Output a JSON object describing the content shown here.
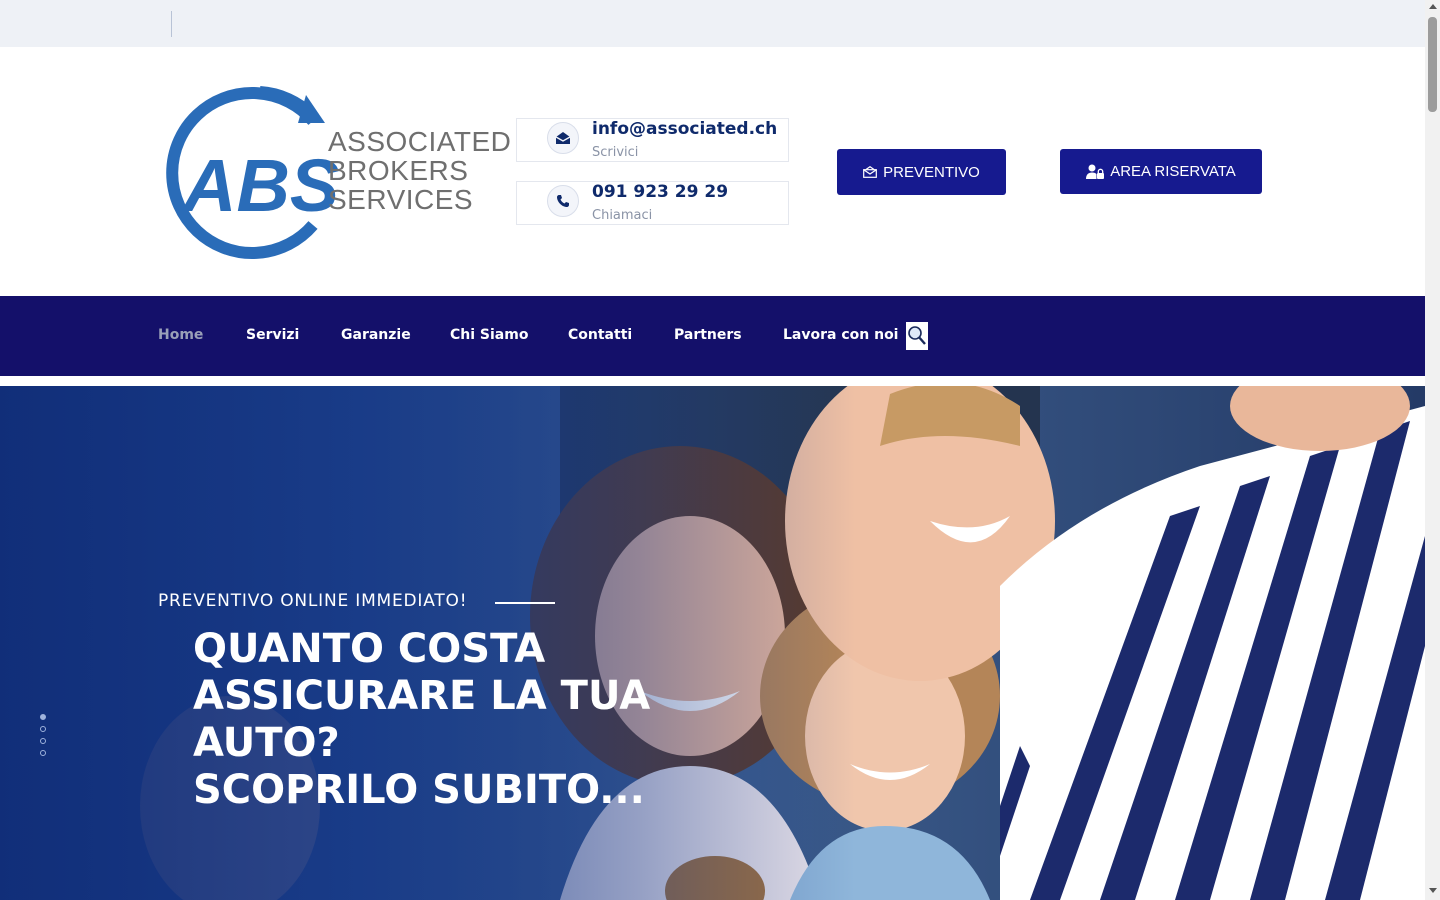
{
  "logo": {
    "initials": "ABS",
    "line1": "ASSOCIATED",
    "line2": "BROKERS",
    "line3": "SERVICES",
    "color": "#2a6cb8"
  },
  "contacts": {
    "email": {
      "value": "info@associated.ch",
      "caption": "Scrivici",
      "icon": "envelope-icon"
    },
    "phone": {
      "value": "091 923 29 29",
      "caption": "Chiamaci",
      "icon": "phone-icon"
    }
  },
  "buttons": {
    "preventivo": {
      "label": "PREVENTIVO",
      "icon": "envelope-outline-icon"
    },
    "area_riservata": {
      "label": "AREA RISERVATA",
      "icon": "user-lock-icon"
    }
  },
  "nav": {
    "items": [
      {
        "label": "Home",
        "active": true
      },
      {
        "label": "Servizi"
      },
      {
        "label": "Garanzie"
      },
      {
        "label": "Chi Siamo"
      },
      {
        "label": "Contatti"
      },
      {
        "label": "Partners"
      },
      {
        "label": "Lavora con noi"
      }
    ],
    "search_icon": "search-icon"
  },
  "hero": {
    "kicker": "PREVENTIVO ONLINE IMMEDIATO!",
    "headline": [
      "QUANTO COSTA",
      "ASSICURARE LA TUA",
      "AUTO?",
      "SCOPRILO SUBITO..."
    ],
    "slide_count": 4,
    "active_slide": 1
  },
  "colors": {
    "brand_navy": "#14106a",
    "button_blue": "#161a8f",
    "contact_text": "#0f2a6b"
  }
}
